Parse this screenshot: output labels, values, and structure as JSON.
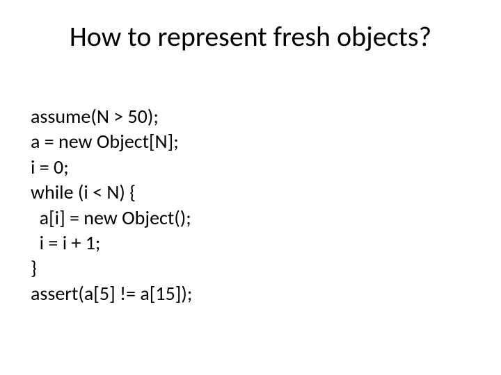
{
  "slide": {
    "title": "How to represent fresh objects?",
    "code": {
      "l1": "assume(N > 50);",
      "l2": "a = new Object[N];",
      "l3": "i = 0;",
      "l4": "while (i < N) {",
      "l5": "  a[i] = new Object();",
      "l6": "  i = i + 1;",
      "l7": "}",
      "l8": "assert(a[5] != a[15]);"
    }
  }
}
